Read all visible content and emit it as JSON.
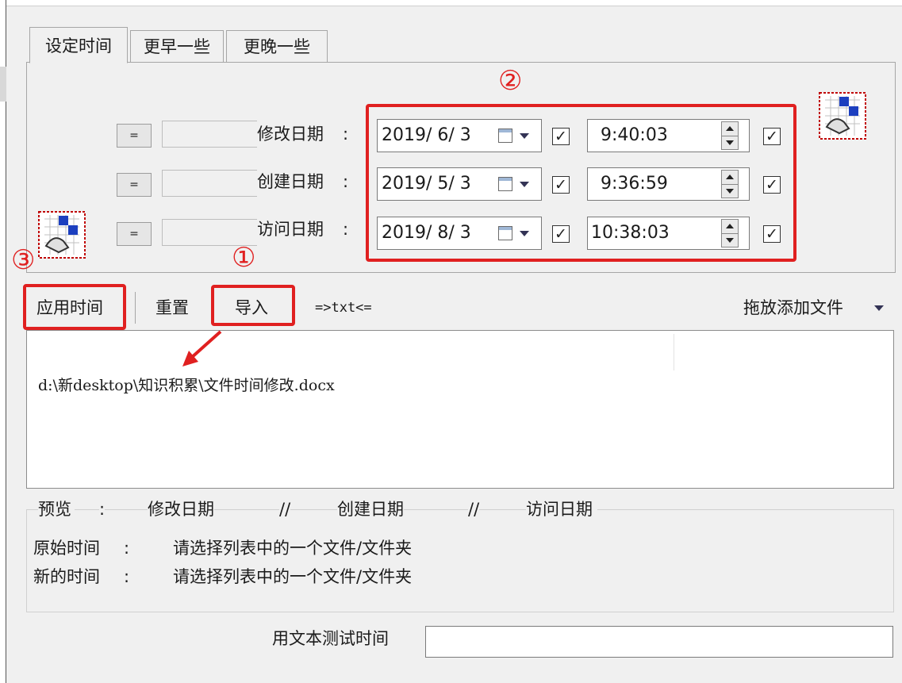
{
  "tabs": [
    {
      "label": "设定时间",
      "active": true
    },
    {
      "label": "更早一些",
      "active": false
    },
    {
      "label": "更晚一些",
      "active": false
    }
  ],
  "rows": [
    {
      "eq_label": "=",
      "label": "修改日期",
      "colon": ":",
      "date": "2019/  6/  3",
      "date_checked": true,
      "time": "9:40:03",
      "time_checked": true
    },
    {
      "eq_label": "=",
      "label": "创建日期",
      "colon": ":",
      "date": "2019/  5/  3",
      "date_checked": true,
      "time": "9:36:59",
      "time_checked": true
    },
    {
      "eq_label": "=",
      "label": "访问日期",
      "colon": ":",
      "date": "2019/  8/  3",
      "date_checked": true,
      "time": "10:38:03",
      "time_checked": true
    }
  ],
  "annotations": {
    "n1": "①",
    "n2": "②",
    "n3": "③",
    "color": "#e02020"
  },
  "toolbar": {
    "apply": "应用时间",
    "reset": "重置",
    "import": "导入",
    "txt": "=>txt<=",
    "drag_add": "拖放添加文件"
  },
  "file_list": [
    "d:\\新desktop\\知识积累\\文件时间修改.docx"
  ],
  "preview": {
    "label": "预览",
    "colon": ":",
    "col_modified": "修改日期",
    "sep1": "//",
    "col_created": "创建日期",
    "sep2": "//",
    "col_accessed": "访问日期",
    "original_label": "原始时间",
    "original_colon": ":",
    "original_value": "请选择列表中的一个文件/文件夹",
    "new_label": "新的时间",
    "new_colon": ":",
    "new_value": "请选择列表中的一个文件/文件夹"
  },
  "test": {
    "label": "用文本测试时间",
    "value": ""
  },
  "icons": {
    "check": "✓",
    "calendar": "calendar-icon",
    "grid": "grid-tool-icon"
  }
}
